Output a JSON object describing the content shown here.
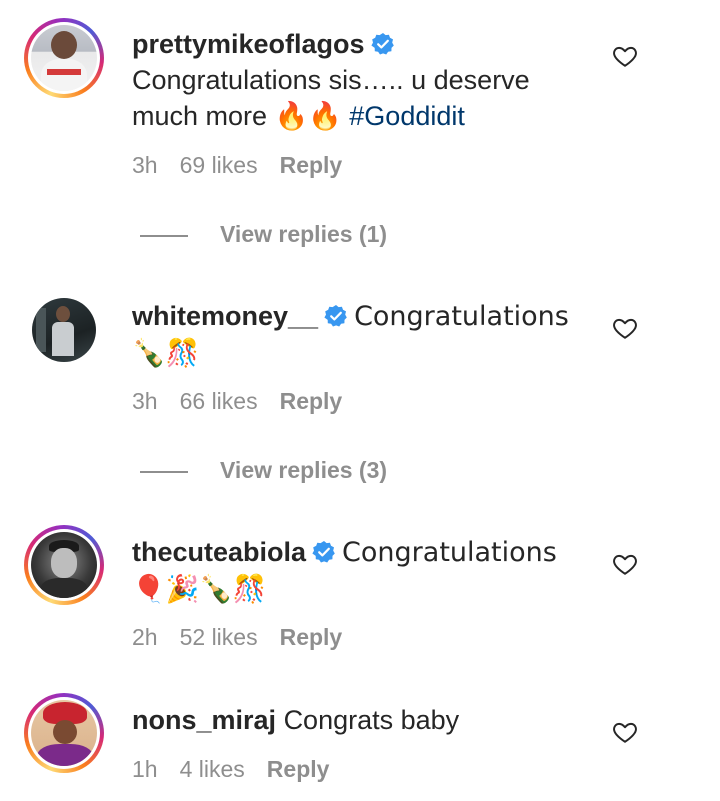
{
  "comments": [
    {
      "username": "prettymikeoflagos",
      "text": "Congratulations sis….. u deserve much more 🔥🔥 ",
      "hashtag": "#Goddidit",
      "time": "3h",
      "likes": "69 likes",
      "reply_label": "Reply",
      "view_replies": "View replies (1)",
      "avatar_icon": "avatar-photo"
    },
    {
      "username": "whitemoney__",
      "text": "Congratulations 🍾🎊",
      "time": "3h",
      "likes": "66 likes",
      "reply_label": "Reply",
      "view_replies": "View replies (3)",
      "avatar_icon": "avatar-photo"
    },
    {
      "username": "thecuteabiola",
      "text": "Congratulations 🎈🎉🍾🎊",
      "time": "2h",
      "likes": "52 likes",
      "reply_label": "Reply",
      "avatar_icon": "avatar-photo"
    },
    {
      "username": "nons_miraj",
      "text": "Congrats baby",
      "time": "1h",
      "likes": "4 likes",
      "reply_label": "Reply",
      "avatar_icon": "avatar-photo"
    }
  ],
  "colors": {
    "verified": "#3897f0",
    "hashtag": "#00376b",
    "meta": "#8e8e8e",
    "text": "#262626"
  }
}
